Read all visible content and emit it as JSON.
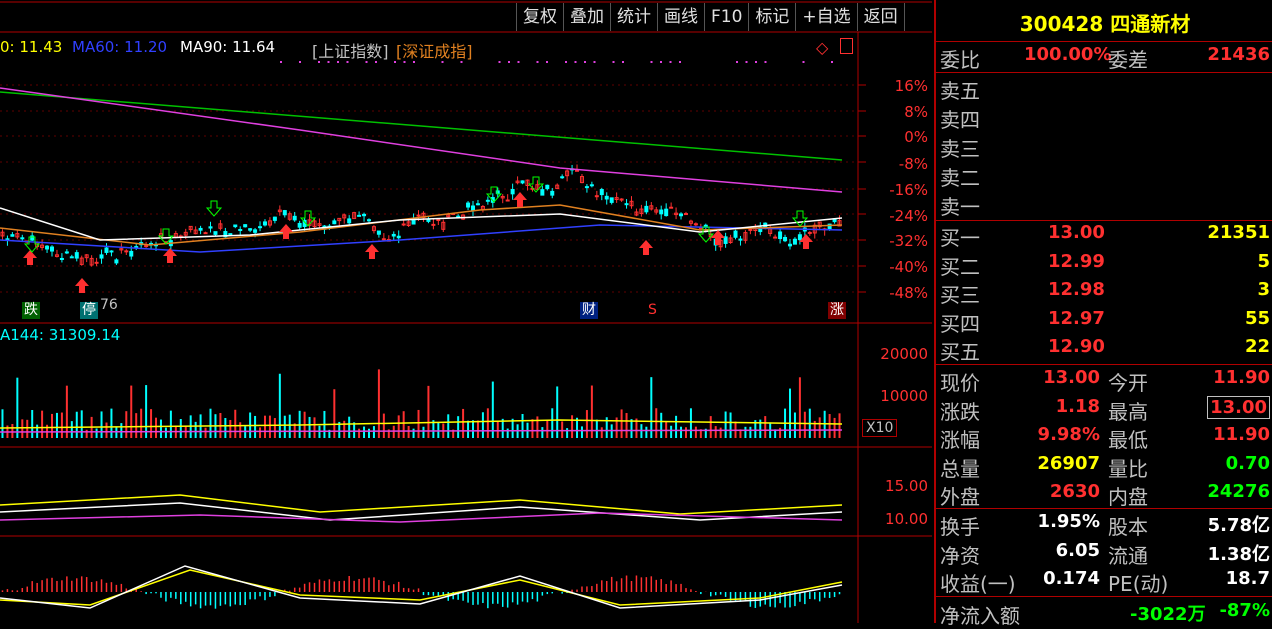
{
  "toolbar": {
    "items": [
      "复权",
      "叠加",
      "统计",
      "画线",
      "F10",
      "标记",
      "+自选",
      "返回"
    ]
  },
  "legend": {
    "ma_partial": "0: 11.43",
    "ma60": "MA60: 11.20",
    "ma90": "MA90: 11.64",
    "index1": "[上证指数]",
    "index2": "[深证成指]"
  },
  "price_axis": [
    "16%",
    "8%",
    "0%",
    "-8%",
    "-16%",
    "-24%",
    "-32%",
    "-40%",
    "-48%"
  ],
  "markers": {
    "die": "跌",
    "ting": "停",
    "ting_value": "76",
    "cai": "财",
    "s": "S",
    "zhang": "涨"
  },
  "volume": {
    "legend": "A144: 31309.14",
    "axis": [
      "20000",
      "10000"
    ],
    "multiplier": "X10"
  },
  "ma_panel": {
    "axis": [
      "15.00",
      "10.00"
    ]
  },
  "colors": {
    "up": "#ff3030",
    "down": "#00ffff",
    "ma_green": "#00c000",
    "ma_magenta": "#e040e0",
    "ma_blue": "#3040ff",
    "ma_orange": "#e08020",
    "ma_white": "#ffffff",
    "ma_yellow": "#ffff00"
  },
  "stock": {
    "code": "300428",
    "name": "四通新材"
  },
  "order_book": {
    "weibi_label": "委比",
    "weibi": "100.00%",
    "weicha_label": "委差",
    "weicha": "21436",
    "sell": [
      {
        "label": "卖五"
      },
      {
        "label": "卖四"
      },
      {
        "label": "卖三"
      },
      {
        "label": "卖二"
      },
      {
        "label": "卖一"
      }
    ],
    "buy": [
      {
        "label": "买一",
        "price": "13.00",
        "vol": "21351"
      },
      {
        "label": "买二",
        "price": "12.99",
        "vol": "5"
      },
      {
        "label": "买三",
        "price": "12.98",
        "vol": "3"
      },
      {
        "label": "买四",
        "price": "12.97",
        "vol": "55"
      },
      {
        "label": "买五",
        "price": "12.90",
        "vol": "22"
      }
    ]
  },
  "quote": [
    {
      "l1": "现价",
      "v1": "13.00",
      "l2": "今开",
      "v2": "11.90",
      "c1": "#ff3030",
      "c2": "#ff3030"
    },
    {
      "l1": "涨跌",
      "v1": "1.18",
      "l2": "最高",
      "v2": "13.00",
      "c1": "#ff3030",
      "c2": "#ff3030"
    },
    {
      "l1": "涨幅",
      "v1": "9.98%",
      "l2": "最低",
      "v2": "11.90",
      "c1": "#ff3030",
      "c2": "#ff3030"
    },
    {
      "l1": "总量",
      "v1": "26907",
      "l2": "量比",
      "v2": "0.70",
      "c1": "#ffff00",
      "c2": "#00ff00"
    },
    {
      "l1": "外盘",
      "v1": "2630",
      "l2": "内盘",
      "v2": "24276",
      "c1": "#ff3030",
      "c2": "#00ff00"
    }
  ],
  "fundamentals": [
    {
      "l1": "换手",
      "v1": "1.95%",
      "l2": "股本",
      "v2": "5.78亿"
    },
    {
      "l1": "净资",
      "v1": "6.05",
      "l2": "流通",
      "v2": "1.38亿"
    },
    {
      "l1": "收益(一)",
      "v1": "0.174",
      "l2": "PE(动)",
      "v2": "18.7"
    }
  ],
  "netflow": {
    "label": "净流入额",
    "value": "-3022万",
    "pct": "-87%"
  }
}
